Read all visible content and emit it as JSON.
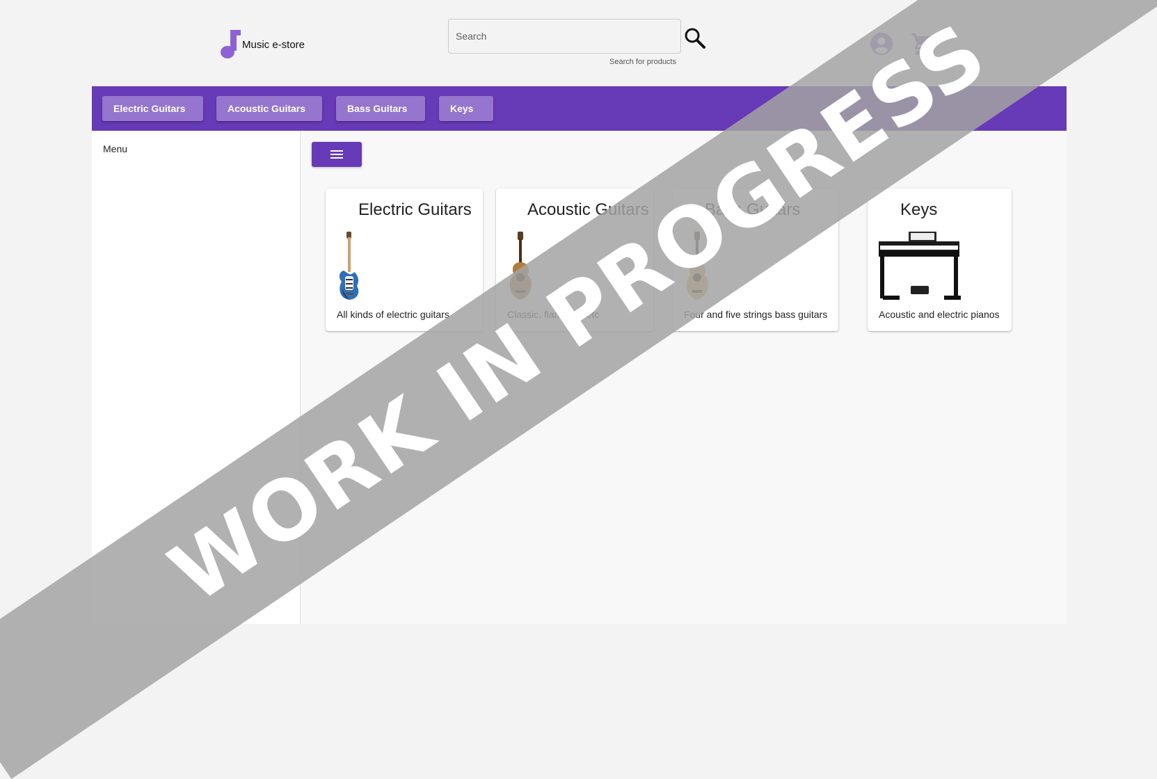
{
  "header": {
    "logo_text": "Music e-store",
    "search": {
      "placeholder": "Search",
      "value": "",
      "hint": "Search for products"
    }
  },
  "nav": {
    "categories": [
      {
        "label": "Electric Guitars"
      },
      {
        "label": "Acoustic Guitars"
      },
      {
        "label": "Bass Guitars"
      },
      {
        "label": "Keys"
      }
    ]
  },
  "sidenav": {
    "title": "Menu"
  },
  "cards": [
    {
      "title": "Electric Guitars",
      "description": "All kinds of electric guitars",
      "icon": "electric-guitar-image"
    },
    {
      "title": "Acoustic Guitars",
      "description": "Classic, flamenco etc",
      "icon": "acoustic-guitar-image"
    },
    {
      "title": "Bass Guitars",
      "description": "Four and five strings bass guitars",
      "icon": "bass-guitar-image"
    },
    {
      "title": "Keys",
      "description": "Acoustic and electric pianos",
      "icon": "digital-piano-image"
    }
  ],
  "watermark": {
    "text": "WORK IN PROGRESS"
  },
  "colors": {
    "primary": "#673ab7",
    "nav_button": "#9575cd",
    "icon_accent": "#9575cd"
  }
}
